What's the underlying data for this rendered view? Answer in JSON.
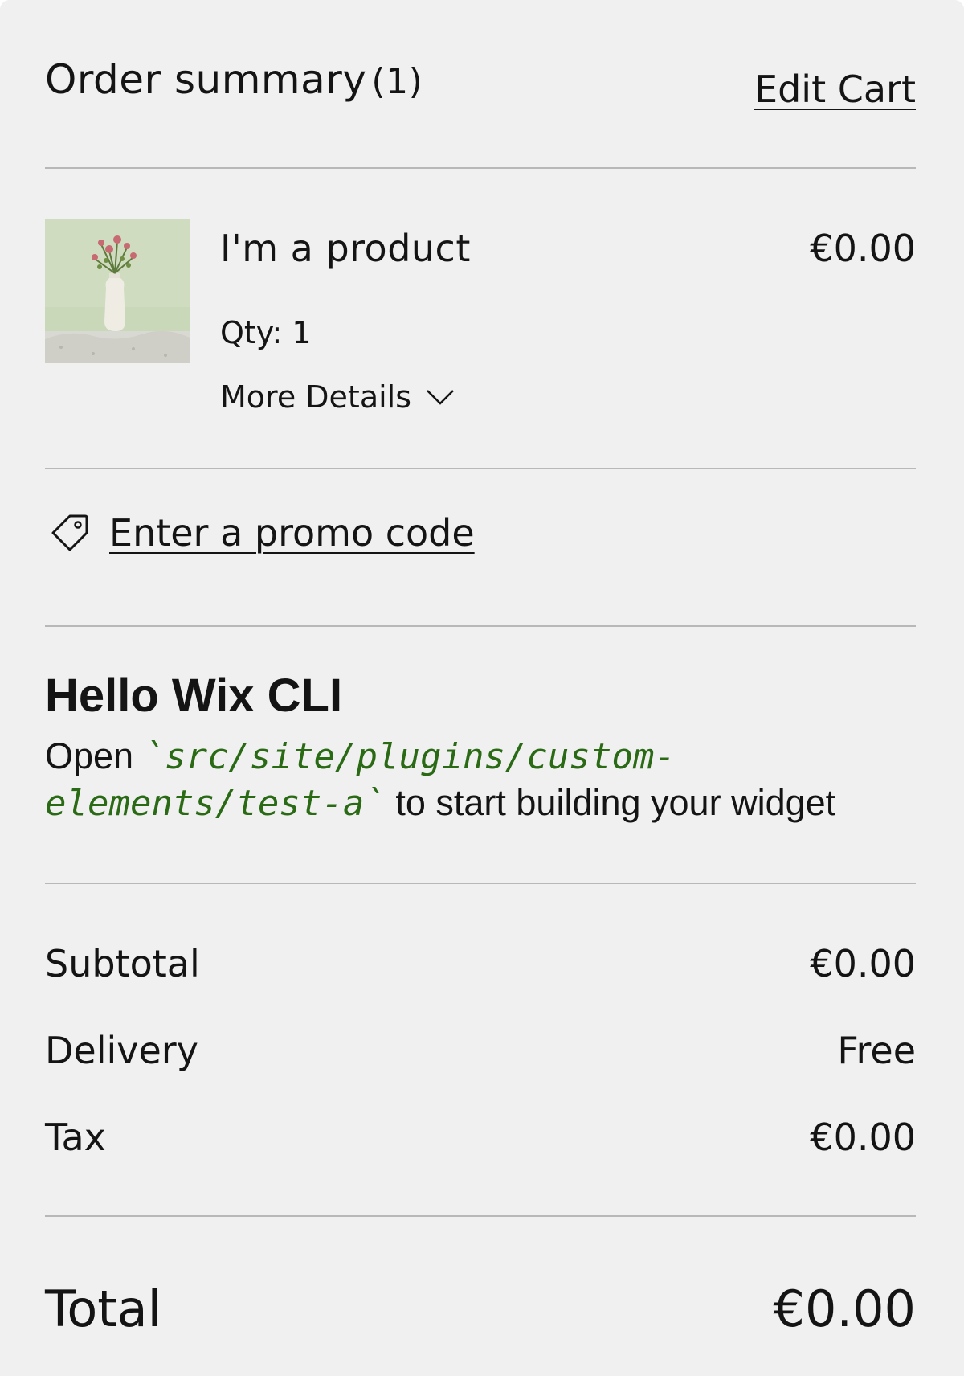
{
  "header": {
    "title": "Order summary",
    "count": "(1)",
    "edit_cart_label": "Edit Cart"
  },
  "item": {
    "image_icon": "product-thumbnail",
    "name": "I'm a product",
    "price": "€0.00",
    "qty": "Qty: 1",
    "more_details_label": "More Details",
    "more_details_icon": "chevron-down-icon"
  },
  "promo": {
    "icon": "tag-icon",
    "label": "Enter a promo code"
  },
  "widget": {
    "title": "Hello Wix CLI",
    "body_prefix": "Open ",
    "code": "`src/site/plugins/custom-elements/test-a`",
    "body_suffix": " to start building your widget"
  },
  "totals": {
    "subtotal_label": "Subtotal",
    "subtotal_value": "€0.00",
    "delivery_label": "Delivery",
    "delivery_value": "Free",
    "tax_label": "Tax",
    "tax_value": "€0.00"
  },
  "total": {
    "label": "Total",
    "value": "€0.00"
  },
  "colors": {
    "background": "#f0f0f0",
    "text": "#141414",
    "divider": "#b8b8b8",
    "code": "#2a6a15"
  }
}
